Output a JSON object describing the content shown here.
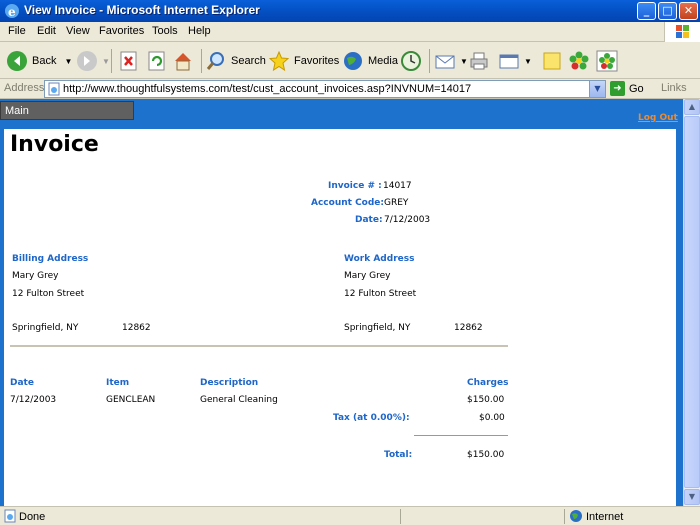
{
  "window": {
    "title": "View Invoice - Microsoft Internet Explorer"
  },
  "menu": [
    "File",
    "Edit",
    "View",
    "Favorites",
    "Tools",
    "Help"
  ],
  "toolbar": {
    "back": "Back",
    "search": "Search",
    "favorites": "Favorites",
    "media": "Media"
  },
  "address": {
    "label": "Address",
    "url": "http://www.thoughtfulsystems.com/test/cust_account_invoices.asp?INVNUM=14017",
    "go": "Go",
    "links": "Links"
  },
  "nav": {
    "main": "Main",
    "logout": "Log Out"
  },
  "invoice": {
    "title": "Invoice",
    "number_label": "Invoice # :",
    "number": "14017",
    "account_label": "Account Code:",
    "account": "GREY",
    "date_label": "Date:",
    "date": "7/12/2003",
    "billing": {
      "label": "Billing Address",
      "name": "Mary Grey",
      "street": "12 Fulton Street",
      "city": "Springfield, NY",
      "zip": "12862"
    },
    "work": {
      "label": "Work Address",
      "name": "Mary  Grey",
      "street": "12 Fulton Street",
      "city": "Springfield, NY",
      "zip": "12862"
    },
    "columns": {
      "date": "Date",
      "item": "Item",
      "description": "Description",
      "charges": "Charges"
    },
    "lines": [
      {
        "date": "7/12/2003",
        "item": "GENCLEAN",
        "description": "General Cleaning",
        "charges": "$150.00"
      }
    ],
    "tax_label": "Tax (at 0.00%):",
    "tax": "$0.00",
    "total_label": "Total:",
    "total": "$150.00"
  },
  "status": {
    "left": "Done",
    "zone": "Internet"
  }
}
